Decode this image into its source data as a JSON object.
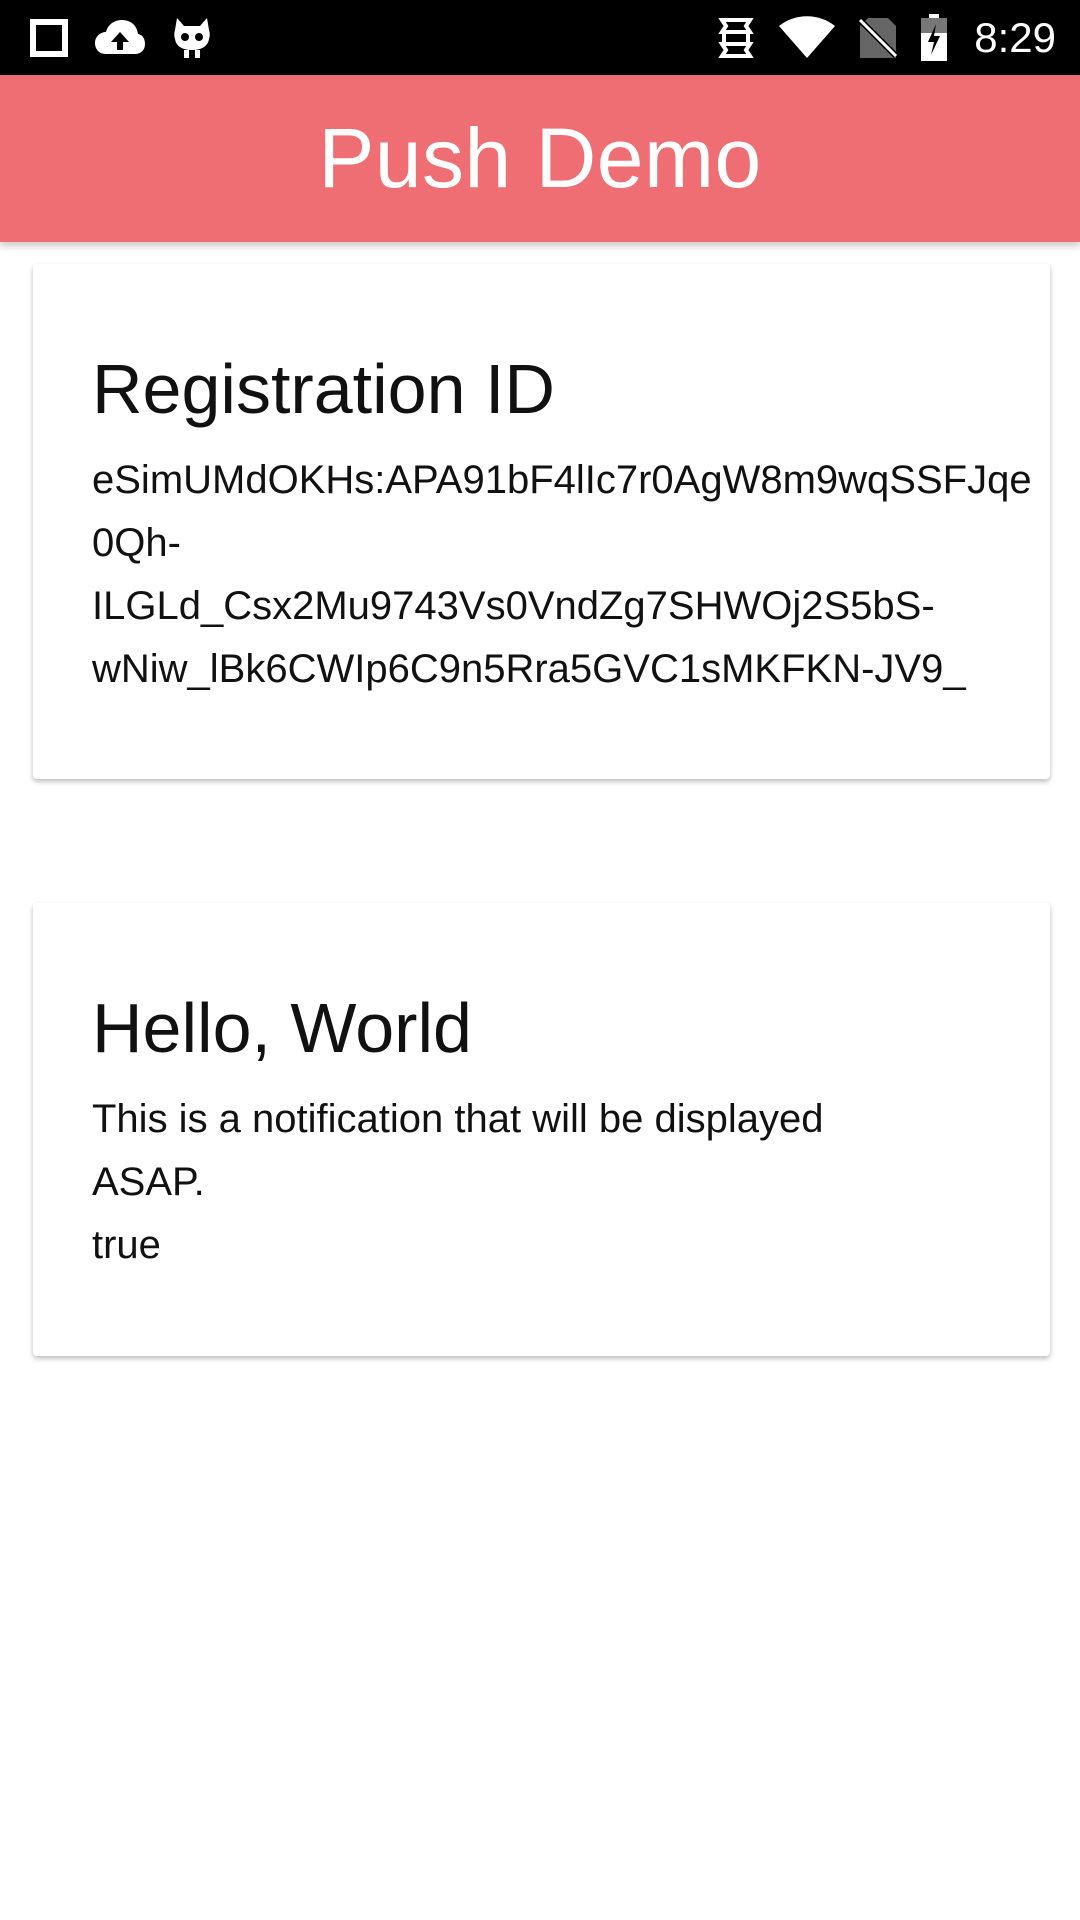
{
  "status_bar": {
    "time": "8:29",
    "icons_left": [
      "square-icon",
      "cloud-upload-icon",
      "cyanogen-mascot-icon"
    ],
    "icons_right": [
      "sync-icon",
      "wifi-icon",
      "no-sim-icon",
      "battery-charging-icon"
    ]
  },
  "app_bar": {
    "title": "Push Demo",
    "color": "#ee6e73"
  },
  "cards": [
    {
      "title": "Registration ID",
      "lines": [
        "eSimUMdOKHs:APA91bF4lIc7r0AgW8m9wqSSFJqe",
        "0Qh-",
        "ILGLd_Csx2Mu9743Vs0VndZg7SHWOj2S5bS-",
        "wNiw_lBk6CWIp6C9n5Rra5GVC1sMKFKN-JV9_"
      ]
    },
    {
      "title": "Hello, World",
      "lines": [
        "This is a notification that will be displayed",
        "ASAP.",
        "true"
      ]
    }
  ]
}
